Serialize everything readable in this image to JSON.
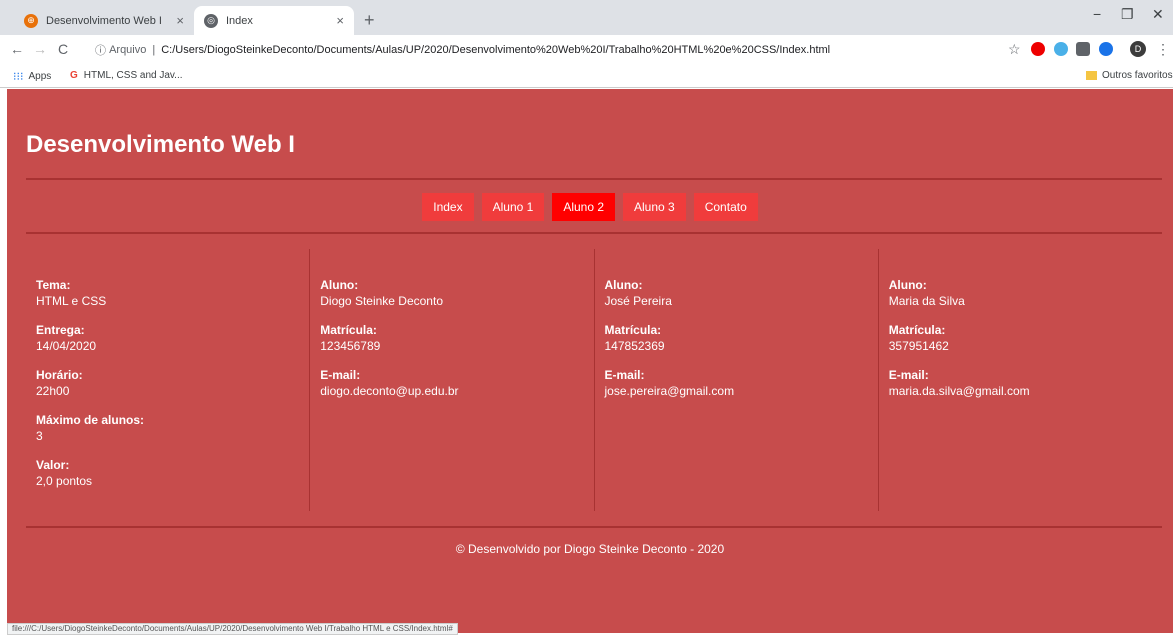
{
  "browser": {
    "tabs": [
      {
        "title": "Desenvolvimento Web I",
        "close": "×"
      },
      {
        "title": "Index",
        "close": "×"
      }
    ],
    "new_tab": "+",
    "window_controls": {
      "minimize": "−",
      "restore": "❐",
      "close": "✕"
    },
    "nav": {
      "back": "←",
      "forward": "→",
      "reload": "C"
    },
    "address": {
      "security_label": "Arquivo",
      "separator": "|",
      "url": "C:/Users/DiogoSteinkeDeconto/Documents/Aulas/UP/2020/Desenvolvimento%20Web%20I/Trabalho%20HTML%20e%20CSS/Index.html"
    },
    "profile_initial": "D",
    "bookmarks": {
      "apps": "Apps",
      "item1": "HTML, CSS and Jav...",
      "other": "Outros favoritos"
    },
    "status_url": "file:///C:/Users/DiogoSteinkeDeconto/Documents/Aulas/UP/2020/Desenvolvimento Web I/Trabalho HTML e CSS/Index.html#"
  },
  "site": {
    "title": "Desenvolvimento Web I",
    "nav": [
      {
        "label": "Index",
        "current": false
      },
      {
        "label": "Aluno 1",
        "current": false
      },
      {
        "label": "Aluno 2",
        "current": true
      },
      {
        "label": "Aluno 3",
        "current": false
      },
      {
        "label": "Contato",
        "current": false
      }
    ],
    "info": [
      {
        "label": "Tema:",
        "value": "HTML e CSS"
      },
      {
        "label": "Entrega:",
        "value": "14/04/2020"
      },
      {
        "label": "Horário:",
        "value": "22h00"
      },
      {
        "label": "Máximo de alunos:",
        "value": "3"
      },
      {
        "label": "Valor:",
        "value": "2,0 pontos"
      }
    ],
    "students": [
      {
        "aluno_label": "Aluno:",
        "aluno": "Diogo Steinke Deconto",
        "mat_label": "Matrícula:",
        "matricula": "123456789",
        "email_label": "E-mail:",
        "email": "diogo.deconto@up.edu.br"
      },
      {
        "aluno_label": "Aluno:",
        "aluno": "José Pereira",
        "mat_label": "Matrícula:",
        "matricula": "147852369",
        "email_label": "E-mail:",
        "email": "jose.pereira@gmail.com"
      },
      {
        "aluno_label": "Aluno:",
        "aluno": "Maria da Silva",
        "mat_label": "Matrícula:",
        "matricula": "357951462",
        "email_label": "E-mail:",
        "email": "maria.da.silva@gmail.com"
      }
    ],
    "footer": "© Desenvolvido por Diogo Steinke Deconto - 2020"
  },
  "colors": {
    "page_bg": "#c74c4c",
    "nav_button": "#f03c3c",
    "nav_current": "#ff0000",
    "rule": "#a83232"
  }
}
